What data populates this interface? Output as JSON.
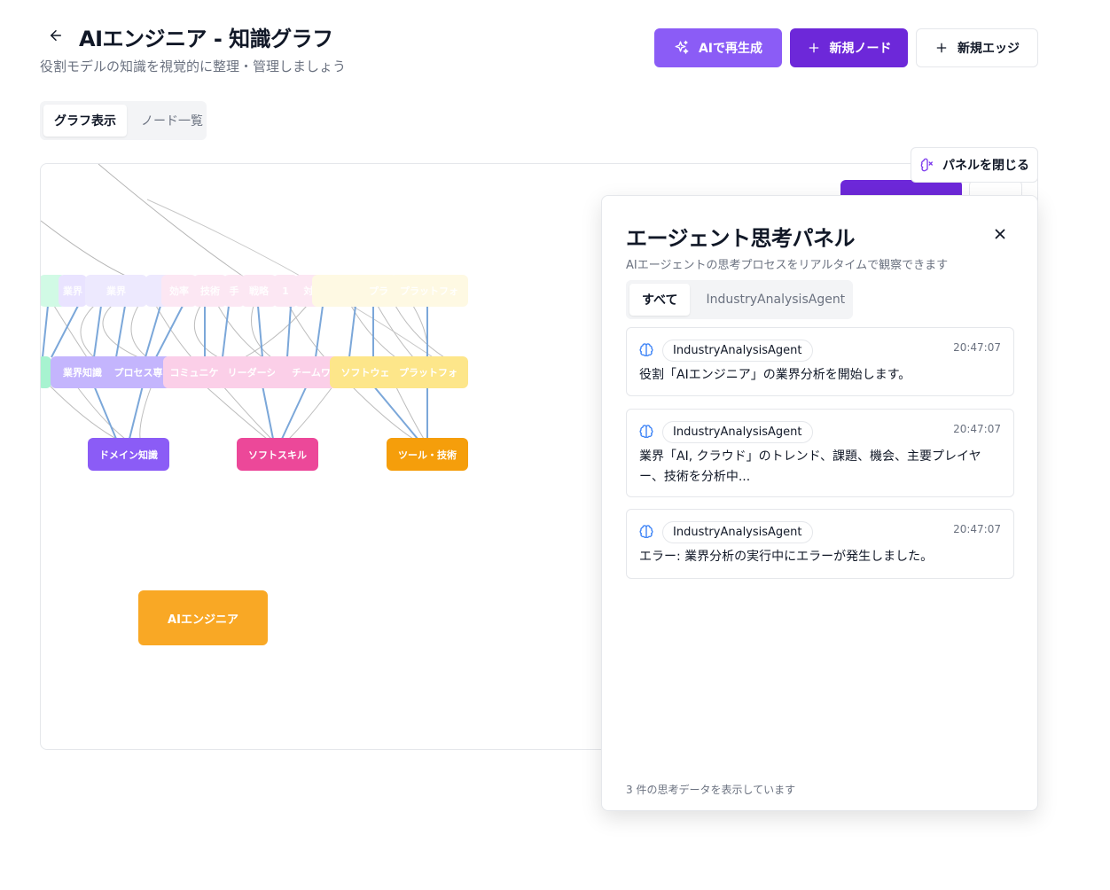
{
  "header": {
    "title": "AIエンジニア - 知識グラフ",
    "subtitle": "役割モデルの知識を視覚的に整理・管理しましょう",
    "buttons": {
      "regenerate": "AIで再生成",
      "new_node": "新規ノード",
      "new_edge": "新規エッジ"
    }
  },
  "view_tabs": [
    "グラフ表示",
    "ノード一覧"
  ],
  "graph": {
    "category_nodes": [
      {
        "label": "ドメイン知識",
        "color": "#8b5cf6"
      },
      {
        "label": "ソフトスキル",
        "color": "#ec4899"
      },
      {
        "label": "ツール・技術",
        "color": "#f59e0b"
      }
    ],
    "skill_nodes": [
      "業界知識",
      "プロセス専",
      "コミュニケ",
      "リーダーシ",
      "チームワ",
      "ソフトウェ",
      "プラットフォ"
    ],
    "top_row_labels": [
      "業界",
      "業界",
      "効率",
      "技術",
      "手",
      "戦略",
      "1",
      "対",
      "プラ",
      "プラットフォ"
    ],
    "root_node": {
      "label": "AIエンジニア",
      "color": "#f9a825"
    }
  },
  "panel_toggle": {
    "label": "パネルを閉じる"
  },
  "panel": {
    "title": "エージェント思考パネル",
    "description": "AIエージェントの思考プロセスをリアルタイムで観察できます",
    "tabs": [
      "すべて",
      "IndustryAnalysisAgent"
    ],
    "entries": [
      {
        "agent": "IndustryAnalysisAgent",
        "time": "20:47:07",
        "message": "役割「AIエンジニア」の業界分析を開始します。"
      },
      {
        "agent": "IndustryAnalysisAgent",
        "time": "20:47:07",
        "message": "業界「AI, クラウド」のトレンド、課題、機会、主要プレイヤー、技術を分析中..."
      },
      {
        "agent": "IndustryAnalysisAgent",
        "time": "20:47:07",
        "message": "エラー: 業界分析の実行中にエラーが発生しました。"
      }
    ],
    "footer": "3 件の思考データを表示しています"
  }
}
